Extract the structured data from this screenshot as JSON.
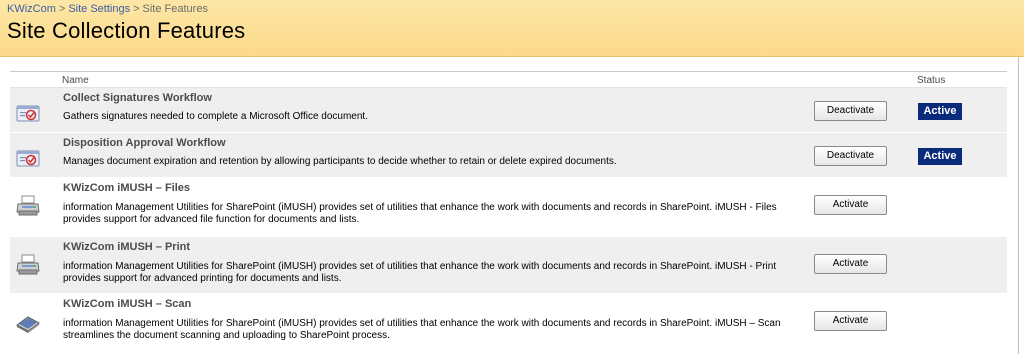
{
  "breadcrumb": {
    "items": [
      "KWizCom",
      "Site Settings",
      "Site Features"
    ],
    "separator": ">"
  },
  "page": {
    "title": "Site Collection Features"
  },
  "table": {
    "columns": {
      "name": "Name",
      "status": "Status"
    },
    "features": [
      {
        "name": "Collect Signatures Workflow",
        "description": "Gathers signatures needed to complete a Microsoft Office document.",
        "button": "Deactivate",
        "status": "Active",
        "icon": "workflow-icon"
      },
      {
        "name": "Disposition Approval Workflow",
        "description": "Manages document expiration and retention by allowing participants to decide whether to retain or delete expired documents.",
        "button": "Deactivate",
        "status": "Active",
        "icon": "workflow-icon"
      },
      {
        "name": "KWizCom iMUSH – Files",
        "description": "information Management Utilities for SharePoint (iMUSH) provides set of utilities that enhance the work with documents and records in SharePoint. iMUSH - Files provides support for advanced file function for documents and lists.",
        "button": "Activate",
        "status": "",
        "icon": "printer-icon"
      },
      {
        "name": "KWizCom iMUSH – Print",
        "description": "information Management Utilities for SharePoint (iMUSH) provides set of utilities that enhance the work with documents and records in SharePoint. iMUSH - Print provides support for advanced printing for documents and lists.",
        "button": "Activate",
        "status": "",
        "icon": "printer-icon"
      },
      {
        "name": "KWizCom iMUSH – Scan",
        "description": "information Management Utilities for SharePoint (iMUSH) provides set of utilities that enhance the work with documents and records in SharePoint. iMUSH – Scan streamlines the document scanning and uploading to SharePoint process.",
        "button": "Activate",
        "status": "",
        "icon": "scanner-icon"
      }
    ]
  },
  "colors": {
    "title_band": "#fcd98a",
    "link": "#3b5ca8",
    "active_badge": "#0a2a7a",
    "shaded_row": "#efefef"
  }
}
